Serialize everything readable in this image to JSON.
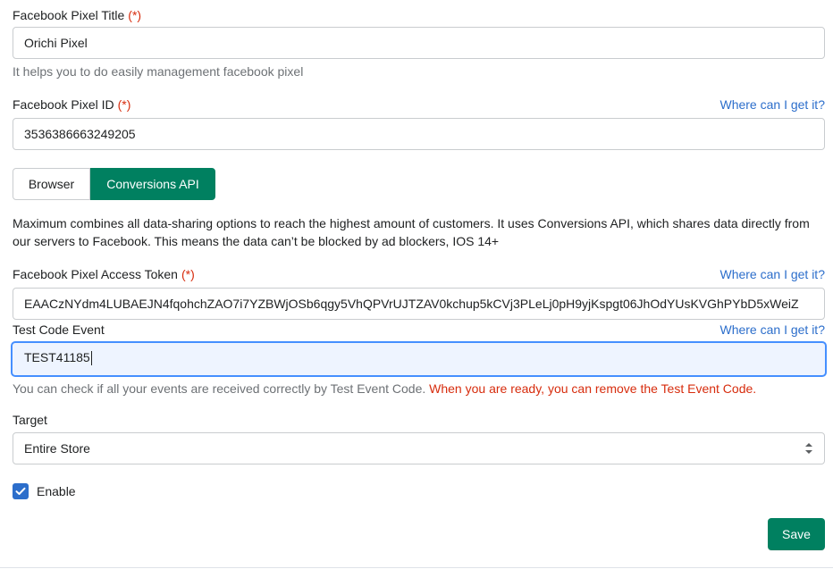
{
  "pixel_title": {
    "label": "Facebook Pixel Title",
    "required_mark": "(*)",
    "value": "Orichi Pixel",
    "help": "It helps you to do easily management facebook pixel"
  },
  "pixel_id": {
    "label": "Facebook Pixel ID",
    "required_mark": "(*)",
    "link": "Where can I get it?",
    "value": "3536386663249205"
  },
  "mode_tabs": {
    "items": [
      {
        "label": "Browser",
        "selected": false
      },
      {
        "label": "Conversions API",
        "selected": true
      }
    ]
  },
  "description": "Maximum combines all data-sharing options to reach the highest amount of customers. It uses Conversions API, which shares data directly from our servers to Facebook. This means the data can’t be blocked by ad blockers, IOS 14+",
  "access_token": {
    "label": "Facebook Pixel Access Token",
    "required_mark": "(*)",
    "link": "Where can I get it?",
    "value": "EAACzNYdm4LUBAEJN4fqohchZAO7i7YZBWjOSb6qgy5VhQPVrUJTZAV0kchup5kCVj3PLeLj0pH9yjKspgt06JhOdYUsKVGhPYbD5xWeiZ"
  },
  "test_code": {
    "label": "Test Code Event",
    "link": "Where can I get it?",
    "value": "TEST41185",
    "help": "You can check if all your events are received correctly by Test Event Code.",
    "warning": "When you are ready, you can remove the Test Event Code."
  },
  "target": {
    "label": "Target",
    "selected": "Entire Store"
  },
  "enable": {
    "label": "Enable",
    "checked": true
  },
  "save_label": "Save",
  "colors": {
    "primary": "#008060",
    "link": "#2c6ecb",
    "required": "#d72c0d",
    "focus_border": "#458fff",
    "focus_bg": "#eef4ff"
  }
}
